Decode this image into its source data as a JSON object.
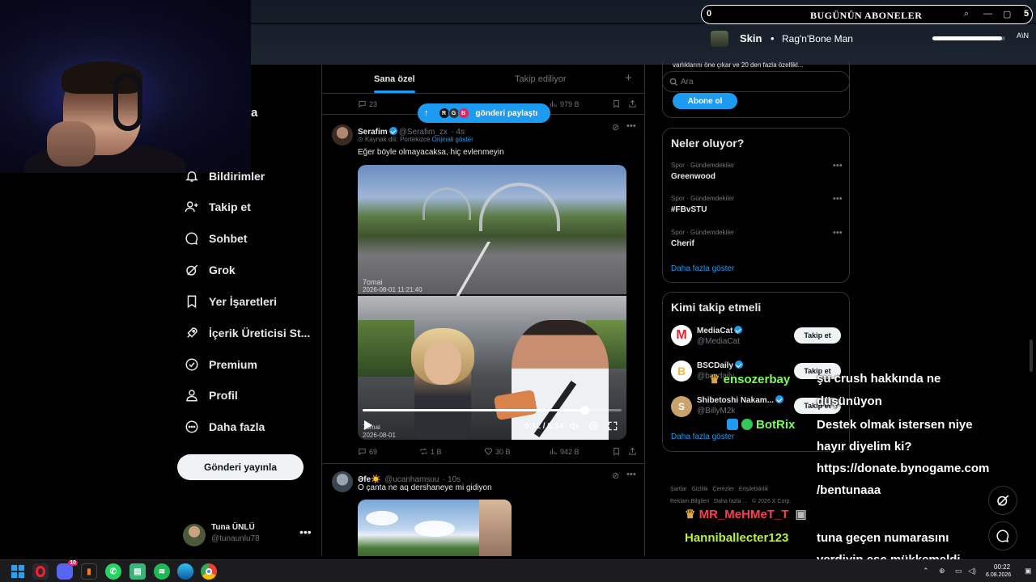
{
  "overlay": {
    "subscribers": {
      "count": "0",
      "title": "BUGÜNÜN ABONELER",
      "right_value": "5"
    },
    "music": {
      "title": "Skin",
      "separator": "•",
      "artist": "Rag'n'Bone Man",
      "progress": 0.95,
      "tag": "A\\N"
    }
  },
  "webcam": {
    "overlap_text": "a"
  },
  "sidebar": {
    "items": [
      {
        "label": "Bildirimler",
        "icon": "bell-icon"
      },
      {
        "label": "Takip et",
        "icon": "person-plus-icon"
      },
      {
        "label": "Sohbet",
        "icon": "chat-bubble-icon"
      },
      {
        "label": "Grok",
        "icon": "grok-icon"
      },
      {
        "label": "Yer İşaretleri",
        "icon": "bookmark-icon"
      },
      {
        "label": "İçerik Üreticisi St...",
        "icon": "rocket-icon"
      },
      {
        "label": "Premium",
        "icon": "premium-icon"
      },
      {
        "label": "Profil",
        "icon": "person-icon"
      },
      {
        "label": "Daha fazla",
        "icon": "more-circle-icon"
      }
    ],
    "post_button": "Gönderi yayınla",
    "profile": {
      "name": "Tuna ÜNLÜ",
      "handle": "@tunaunlu78",
      "more": "•••"
    }
  },
  "feed": {
    "tabs": [
      "Sana özel",
      "Takip ediliyor"
    ],
    "tab_add": "+",
    "top_actions": {
      "replies": "23",
      "views": "979 B"
    },
    "share_pill": {
      "label": "gönderi paylaştı",
      "avatars": [
        "R",
        "G",
        "B"
      ]
    },
    "post1": {
      "name": "Serafim",
      "handle": "@Serafim_zx",
      "time": "· 4s",
      "translate_note": "Kaynak dili: Portekizce",
      "translate_link": "Orijinali göster",
      "text": "Eğer böyle olmayacaksa, hiç evlenmeyin",
      "video": {
        "watermark_top": "7omai",
        "timestamp_top": "2026-08-01  11:21:40",
        "watermark_bottom": "7omai",
        "timestamp_bottom": "2026-08-01",
        "time": "0:12 / 0:14",
        "progress": 0.857
      },
      "actions": {
        "replies": "69",
        "reposts": "1 B",
        "likes": "30 B",
        "views": "942 B"
      }
    },
    "post2": {
      "name": "Əfe☀️",
      "handle": "@ucanhamsuu",
      "time": "· 10s",
      "text": "O çanta ne aq dershaneye mi gidiyon"
    }
  },
  "right": {
    "premium_text": "varlıklarını öne çıkar ve 20 den fazla özellikl...",
    "search_placeholder": "Ara",
    "subscribe": "Abone ol",
    "trends_title": "Neler oluyor?",
    "trends": [
      {
        "category": "Spor · Gündemdekiler",
        "name": "Greenwood"
      },
      {
        "category": "Spor · Gündemdekiler",
        "name": "#FBvSTU"
      },
      {
        "category": "Spor · Gündemdekiler",
        "name": "Cherif"
      }
    ],
    "trends_more": "Daha fazla göster",
    "follow_title": "Kimi takip etmeli",
    "follows": [
      {
        "name": "MediaCat",
        "handle": "@MediaCat",
        "button": "Takip et",
        "color": "#e8222b",
        "letter": "M"
      },
      {
        "name": "BSCDaily",
        "handle": "@bscdaily",
        "button": "Takip et",
        "color": "#f3ba2f",
        "letter": "B"
      },
      {
        "name": "Shibetoshi Nakam...",
        "handle": "@BillyM2k",
        "button": "Takip et",
        "color": "#c9a36b",
        "letter": "S"
      }
    ],
    "follow_more": "Daha fazla göster",
    "footer": [
      "Şartlar",
      "Gizlilik",
      "Çerezler",
      "Erişilebilirlik",
      "Reklam Bilgileri",
      "Daha fazla ...",
      "© 2026 X Corp."
    ]
  },
  "chat": [
    {
      "user": "ensozerbay",
      "lines": [
        "şu crush hakkında ne",
        "düşünüyon"
      ]
    },
    {
      "user": "BotRix",
      "lines": [
        "Destek olmak istersen niye",
        "hayır diyelim ki?",
        "https://donate.bynogame.com",
        "/bentunaaa"
      ]
    },
    {
      "user": "MR_MeHMeT_T",
      "lines": [
        ""
      ]
    },
    {
      "user": "Hanniballecter123",
      "lines": [
        "tuna geçen numarasını",
        "verdiyin esc mükkemeldi"
      ]
    }
  ],
  "taskbar": {
    "time": "00:22",
    "date": "6.08.2026",
    "apps": [
      "start",
      "opera",
      "discord",
      "file",
      "whatsapp",
      "obs",
      "spotify",
      "edge",
      "chrome"
    ],
    "discord_badge": "10"
  },
  "colors": {
    "accent": "#1d9bf0",
    "background": "#000000",
    "border": "#2f3336"
  }
}
